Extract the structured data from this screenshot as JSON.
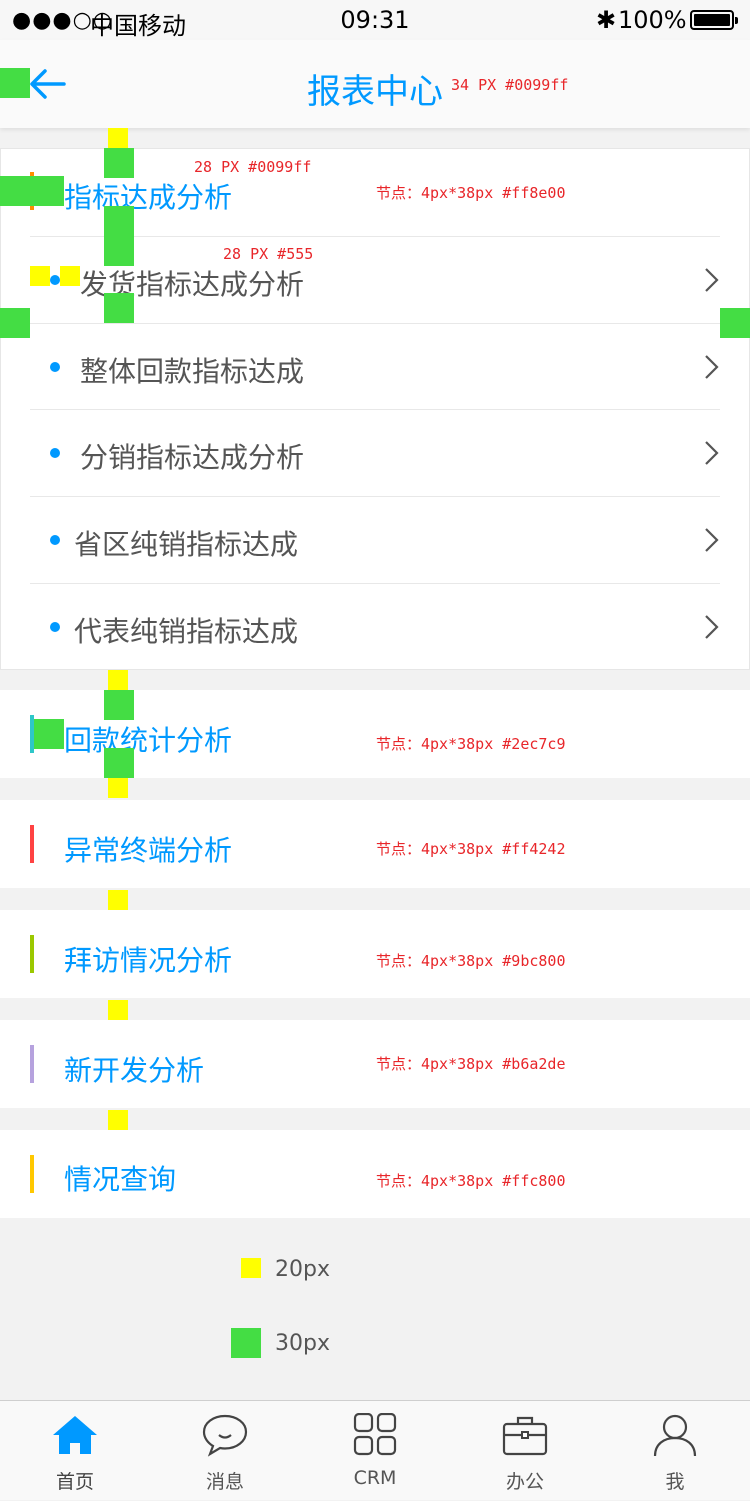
{
  "status_bar": {
    "signal": "●●●○○",
    "carrier": "中国移动",
    "time": "09:31",
    "battery": "100%"
  },
  "nav": {
    "title": "报表中心",
    "title_annotation": "34 PX   #0099ff"
  },
  "annotations": {
    "title_size": "28 PX   #0099ff",
    "item_size": "28 PX   #555"
  },
  "sections": [
    {
      "title": "指标达成分析",
      "bar_color": "#ff8e00",
      "note": "节点：4px*38px #ff8e00",
      "items": [
        "发货指标达成分析",
        "整体回款指标达成",
        "分销指标达成分析",
        "省区纯销指标达成",
        "代表纯销指标达成"
      ]
    },
    {
      "title": "回款统计分析",
      "bar_color": "#2ec7c9",
      "note": "节点：4px*38px #2ec7c9"
    },
    {
      "title": "异常终端分析",
      "bar_color": "#ff4242",
      "note": "节点：4px*38px #ff4242"
    },
    {
      "title": "拜访情况分析",
      "bar_color": "#9bc800",
      "note": "节点：4px*38px #9bc800"
    },
    {
      "title": "新开发分析",
      "bar_color": "#b6a2de",
      "note": "节点：4px*38px #b6a2de"
    },
    {
      "title": "情况查询",
      "bar_color": "#ffc800",
      "note": "节点：4px*38px #ffc800"
    }
  ],
  "legend": {
    "yellow": "20px",
    "green": "30px",
    "yellow_color": "#ffff00",
    "green_color": "#44dd44"
  },
  "tabbar": {
    "tabs": [
      {
        "label": "首页",
        "icon": "home-icon",
        "active": true
      },
      {
        "label": "消息",
        "icon": "message-icon"
      },
      {
        "label": "CRM",
        "icon": "grid-icon"
      },
      {
        "label": "办公",
        "icon": "briefcase-icon"
      },
      {
        "label": "我",
        "icon": "user-icon"
      }
    ]
  },
  "colors": {
    "accent": "#0099ff",
    "item_text": "#555"
  }
}
